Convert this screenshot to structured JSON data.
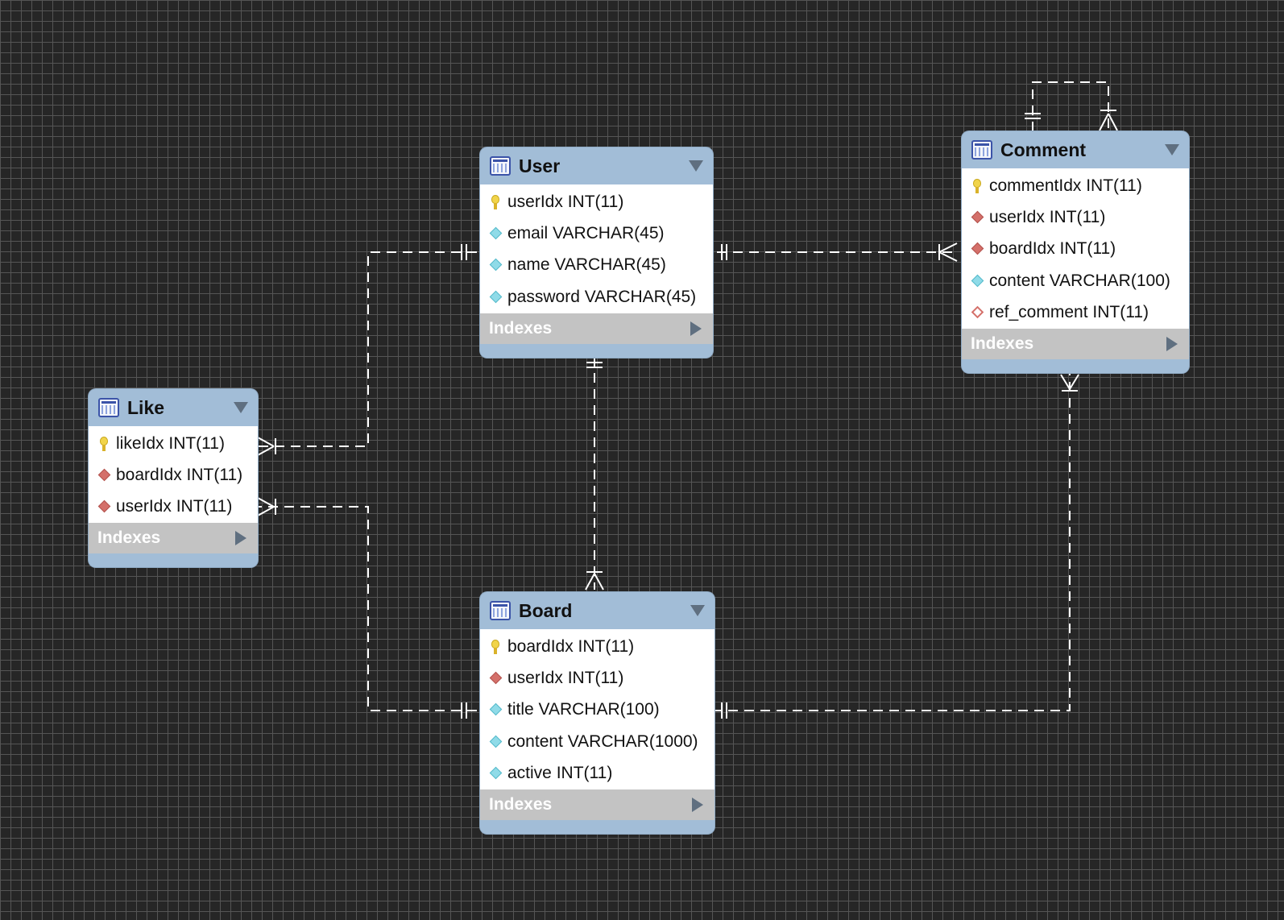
{
  "diagram": {
    "entities": {
      "user": {
        "name": "User",
        "columns": [
          {
            "text": "userIdx INT(11)",
            "key": "pk"
          },
          {
            "text": "email VARCHAR(45)",
            "key": "attr"
          },
          {
            "text": "name VARCHAR(45)",
            "key": "attr"
          },
          {
            "text": "password VARCHAR(45)",
            "key": "attr"
          }
        ],
        "indexes_label": "Indexes"
      },
      "comment": {
        "name": "Comment",
        "columns": [
          {
            "text": "commentIdx INT(11)",
            "key": "pk"
          },
          {
            "text": "userIdx INT(11)",
            "key": "fk"
          },
          {
            "text": "boardIdx INT(11)",
            "key": "fk"
          },
          {
            "text": "content VARCHAR(100)",
            "key": "attr"
          },
          {
            "text": "ref_comment INT(11)",
            "key": "nullable"
          }
        ],
        "indexes_label": "Indexes"
      },
      "like": {
        "name": "Like",
        "columns": [
          {
            "text": "likeIdx INT(11)",
            "key": "pk"
          },
          {
            "text": "boardIdx INT(11)",
            "key": "fk"
          },
          {
            "text": "userIdx INT(11)",
            "key": "fk"
          }
        ],
        "indexes_label": "Indexes"
      },
      "board": {
        "name": "Board",
        "columns": [
          {
            "text": "boardIdx INT(11)",
            "key": "pk"
          },
          {
            "text": "userIdx INT(11)",
            "key": "fk"
          },
          {
            "text": "title VARCHAR(100)",
            "key": "attr"
          },
          {
            "text": "content VARCHAR(1000)",
            "key": "attr"
          },
          {
            "text": "active INT(11)",
            "key": "attr"
          }
        ],
        "indexes_label": "Indexes"
      }
    },
    "relationships": [
      {
        "from": "User",
        "to": "Comment",
        "from_cardinality": "one-and-only-one",
        "to_cardinality": "one-or-many"
      },
      {
        "from": "User",
        "to": "Like",
        "from_cardinality": "one-and-only-one",
        "to_cardinality": "one-or-many"
      },
      {
        "from": "User",
        "to": "Board",
        "from_cardinality": "one-and-only-one",
        "to_cardinality": "one-or-many"
      },
      {
        "from": "Board",
        "to": "Like",
        "from_cardinality": "one-and-only-one",
        "to_cardinality": "one-or-many"
      },
      {
        "from": "Board",
        "to": "Comment",
        "from_cardinality": "one-and-only-one",
        "to_cardinality": "one-or-many"
      },
      {
        "from": "Comment",
        "to": "Comment",
        "from_cardinality": "one-and-only-one",
        "to_cardinality": "one-or-many"
      }
    ],
    "colors": {
      "background": "#262626",
      "grid": "#555555",
      "header": "#a2bdd7",
      "indexes_bar": "#c3c3c3",
      "connector": "#ffffff",
      "pk_icon": "#f1d44a",
      "fk_icon": "#d4706a",
      "attr_icon": "#8fdbe8"
    }
  }
}
